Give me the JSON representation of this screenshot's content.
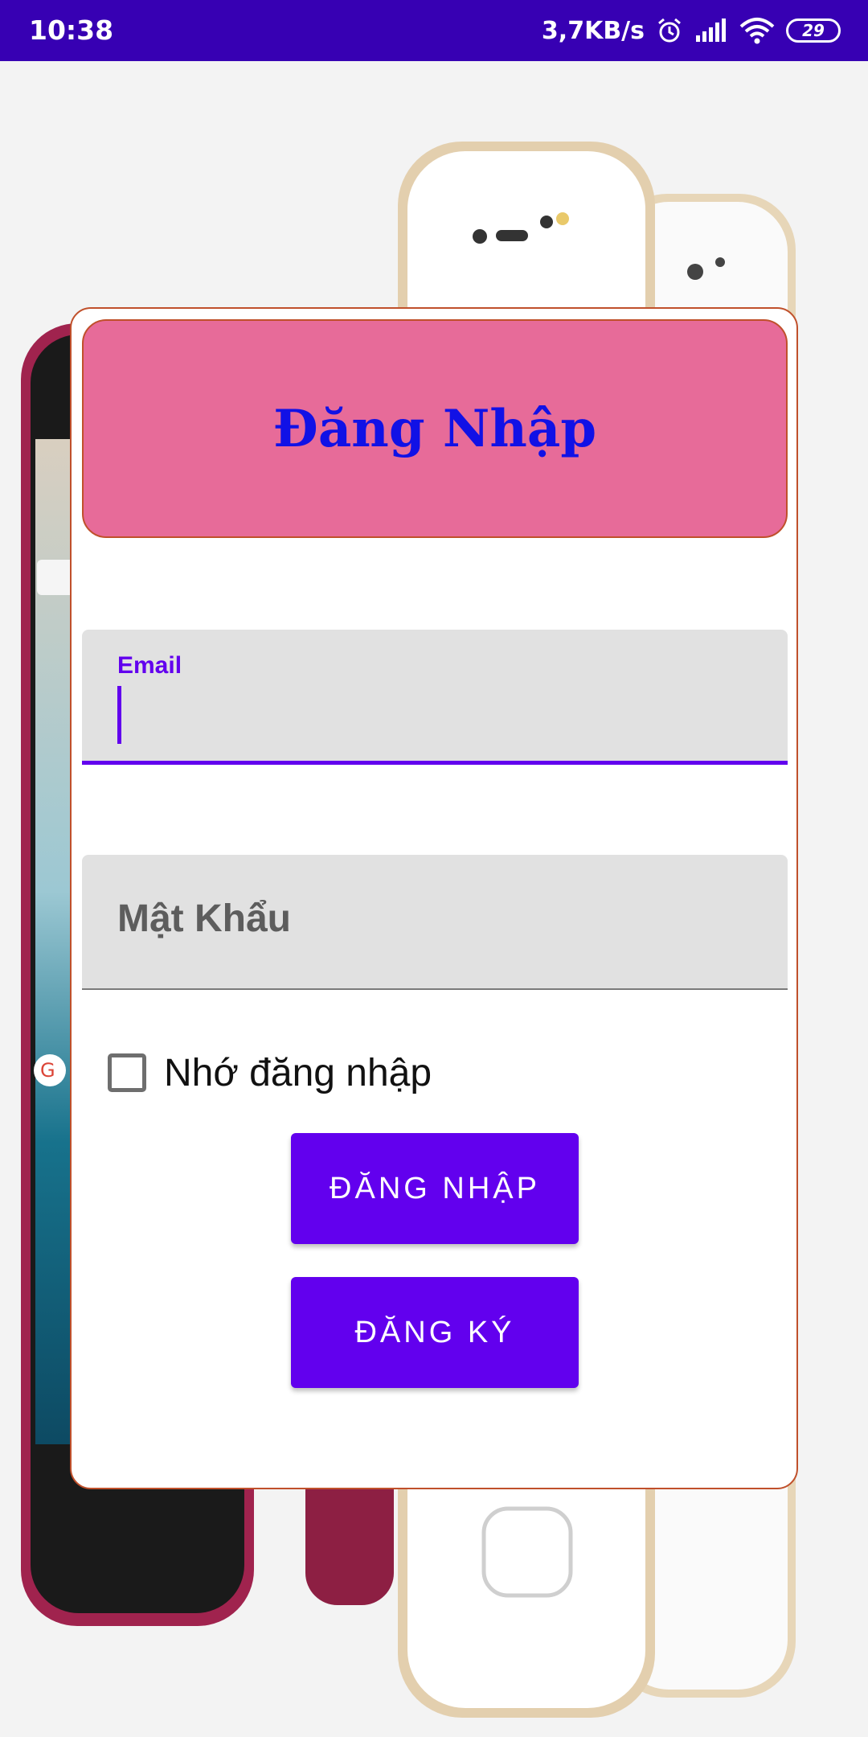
{
  "status_bar": {
    "time": "10:38",
    "net_speed": "3,7KB/s",
    "battery": "29",
    "icons": [
      "alarm-icon",
      "signal-icon",
      "wifi-icon",
      "battery-icon"
    ],
    "background_color": "#3700b3"
  },
  "login": {
    "title": "Đăng Nhập",
    "email_label": "Email",
    "email_value": "",
    "password_placeholder": "Mật Khẩu",
    "remember_label": "Nhớ đăng nhập",
    "remember_checked": false,
    "login_button": "ĐĂNG NHẬP",
    "register_button": "ĐĂNG KÝ"
  },
  "colors": {
    "accent": "#6200ee",
    "header_bg": "#e76b99",
    "title_color": "#1111e6",
    "card_border": "#c0502b"
  }
}
